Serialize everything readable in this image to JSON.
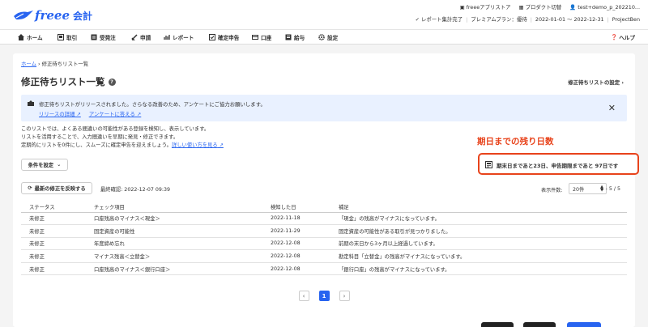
{
  "brand": {
    "logo": "freee",
    "product": "会計"
  },
  "top_links": {
    "app_store": "freeeアプリストア",
    "switch_product": "プロダクト切替",
    "user": "test+demo_p_202210..."
  },
  "top_status": {
    "report": "✓ レポート集計完了",
    "plan": "プレミアムプラン：優待",
    "period": "2022-01-01 ～ 2022-12-31",
    "company": "ProjectBen"
  },
  "nav": {
    "items": [
      {
        "label": "ホーム",
        "icon": "home-icon"
      },
      {
        "label": "取引",
        "icon": "transaction-icon"
      },
      {
        "label": "受発注",
        "icon": "order-icon"
      },
      {
        "label": "申請",
        "icon": "request-icon"
      },
      {
        "label": "レポート",
        "icon": "report-icon"
      },
      {
        "label": "確定申告",
        "icon": "tax-return-icon"
      },
      {
        "label": "口座",
        "icon": "account-icon"
      },
      {
        "label": "給与",
        "icon": "payroll-icon"
      },
      {
        "label": "設定",
        "icon": "gear-icon"
      }
    ],
    "help": "ヘルプ"
  },
  "breadcrumb": {
    "home": "ホーム",
    "current": "修正待ちリスト一覧"
  },
  "page": {
    "title": "修正待ちリスト一覧",
    "settings_link": "修正待ちリストの設定"
  },
  "notice": {
    "text": "修正待ちリストがリリースされました。さらなる改善のため、アンケートにご協力お願いします。",
    "link1": "リリースの詳細",
    "link2": "アンケートに答える"
  },
  "description": {
    "line1": "このリストでは、よくある間違いの可能性がある登録を検知し、表示しています。",
    "line2": "リストを活用することで、入力間違いを早期に発見・修正できます。",
    "line3": "定期的にリストを0件にし、スムーズに確定申告を迎えましょう。",
    "link": "詳しい使い方を見る"
  },
  "filter_button": "条件を設定",
  "deadline": {
    "title": "期日までの残り日数",
    "text": "期末日まであと23日、申告期限まであと 97日です"
  },
  "toolbar": {
    "reflect_button": "最新の修正を反映する",
    "last_checked": "最終確認: 2022-12-07 09:39",
    "per_page_label": "表示件数:",
    "per_page_value": "20件",
    "range": "1 - 5 / 5"
  },
  "table": {
    "headers": [
      "ステータス",
      "チェック項目",
      "検知した日",
      "補足"
    ],
    "rows": [
      [
        "未修正",
        "口座残高のマイナス＜現金＞",
        "2022-11-18",
        "「現金」の残高がマイナスになっています。"
      ],
      [
        "未修正",
        "固定資産の可能性",
        "2022-11-29",
        "固定資産の可能性がある取引が見つかりました。"
      ],
      [
        "未修正",
        "年度締め忘れ",
        "2022-12-08",
        "前期の末日から3ヶ月以上経過しています。"
      ],
      [
        "未修正",
        "マイナス残高＜立替金＞",
        "2022-12-08",
        "勘定科目「立替金」の残高がマイナスになっています。"
      ],
      [
        "未修正",
        "口座残高のマイナス＜銀行口座＞",
        "2022-12-08",
        "「銀行口座」の残高がマイナスになっています。"
      ]
    ]
  },
  "pagination": {
    "prev": "‹",
    "current": "1",
    "next": "›"
  },
  "colors": {
    "brand": "#2864f0",
    "alert": "#e8431b",
    "notice_bg": "#e9f1ff"
  }
}
